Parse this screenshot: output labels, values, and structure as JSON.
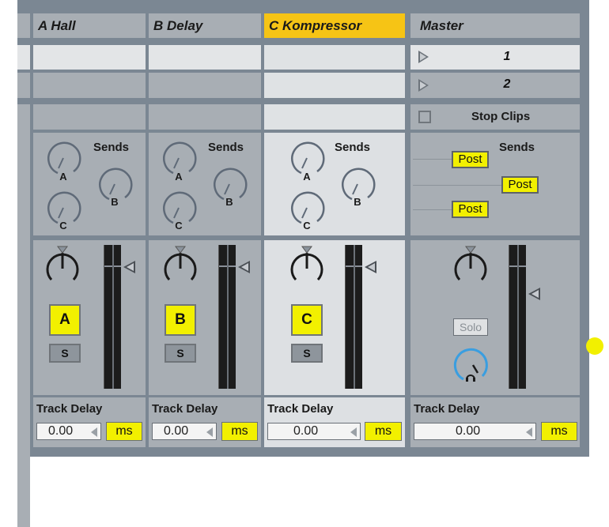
{
  "tracks": [
    {
      "name": "A Hall",
      "letter": "A",
      "solo": "S",
      "selected": false
    },
    {
      "name": "B Delay",
      "letter": "B",
      "solo": "S",
      "selected": false
    },
    {
      "name": "C Kompressor",
      "letter": "C",
      "solo": "S",
      "selected": true
    }
  ],
  "sends": {
    "label": "Sends",
    "knobs": [
      "A",
      "B",
      "C"
    ]
  },
  "master": {
    "name": "Master",
    "scenes": [
      "1",
      "2"
    ],
    "stop_clips": "Stop Clips",
    "sends_label": "Sends",
    "post": [
      "Post",
      "Post",
      "Post"
    ],
    "solo": "Solo"
  },
  "track_delay": {
    "label": "Track Delay",
    "value": "0.00",
    "unit": "ms"
  },
  "colors": {
    "selected": "#f6c415",
    "button": "#f2f000",
    "cue_knob": "#3a9ee0"
  }
}
